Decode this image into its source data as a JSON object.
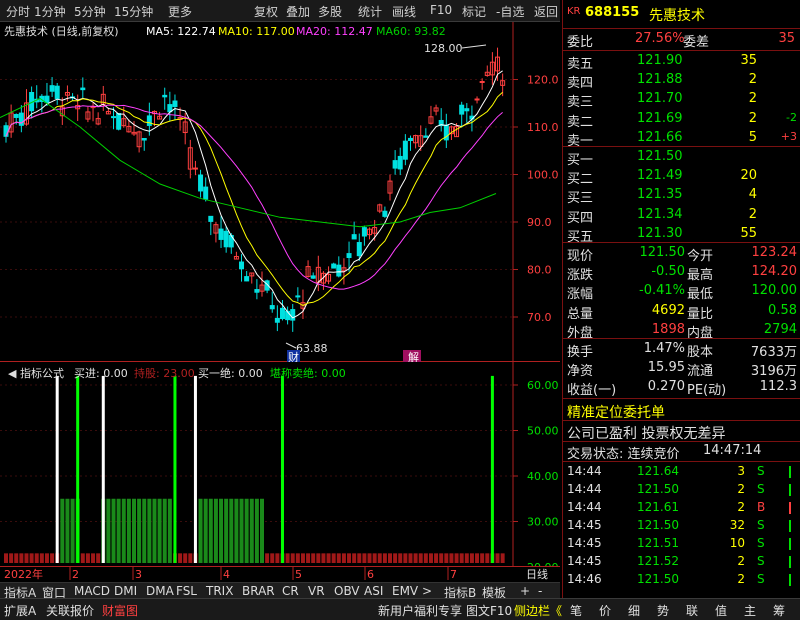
{
  "toolbar": {
    "items": [
      "分时",
      "1分钟",
      "5分钟",
      "15分钟",
      "更多",
      "复权",
      "叠加",
      "多股",
      "统计",
      "画线",
      "F10",
      "标记",
      "-自选",
      "返回"
    ]
  },
  "chart": {
    "title": "先惠技术 (日线,前复权)",
    "ma5": "MA5: 122.74",
    "ma10": "MA10: 117.00",
    "ma20": "MA20: 112.47",
    "ma60": "MA60: 93.82",
    "high_label": "128.00",
    "low_label": "63.88",
    "price_ticks": [
      "120.0",
      "110.0",
      "100.0",
      "90.0",
      "80.0",
      "70.0"
    ],
    "marker_cai": "财",
    "marker_jie": "解",
    "colors": {
      "up": "#ff4040",
      "down": "#00e0e0",
      "ma5": "#ffffff",
      "ma10": "#ffff00",
      "ma20": "#ff40ff",
      "ma60": "#00d000"
    }
  },
  "indicator": {
    "name": "指标公式",
    "buy": "买进: 0.00",
    "hold": "持股: 23.00",
    "buy_one": "买一绝: 0.00",
    "sell": "堪称卖绝: 0.00",
    "ticks": [
      "60.00",
      "50.00",
      "40.00",
      "30.00",
      "20.00"
    ]
  },
  "date_axis": {
    "year": "2022年",
    "months": [
      "2",
      "3",
      "4",
      "5",
      "6",
      "7"
    ],
    "period": "日线"
  },
  "tabs": [
    "指标A",
    "窗口",
    "MACD",
    "DMI",
    "DMA",
    "FSL",
    "TRIX",
    "BRAR",
    "CR",
    "VR",
    "OBV",
    "ASI",
    "EMV",
    ">",
    "指标B",
    "模板",
    "+",
    "-"
  ],
  "bottom": {
    "left": [
      "扩展A",
      "关联报价",
      "财富图"
    ],
    "right": [
      "新用户福利专享",
      "图文F10",
      "侧边栏《"
    ],
    "panel_tabs": [
      "笔",
      "价",
      "细",
      "势",
      "联",
      "值",
      "主",
      "筹"
    ]
  },
  "quote": {
    "badge": "KR",
    "code": "688155",
    "name": "先惠技术",
    "weibi_label": "委比",
    "weibi": "27.56%",
    "weicha_label": "委差",
    "weicha": "35",
    "asks": [
      {
        "l": "卖五",
        "p": "121.90",
        "v": "35",
        "c": ""
      },
      {
        "l": "卖四",
        "p": "121.88",
        "v": "2",
        "c": ""
      },
      {
        "l": "卖三",
        "p": "121.70",
        "v": "2",
        "c": ""
      },
      {
        "l": "卖二",
        "p": "121.69",
        "v": "2",
        "c": "-2"
      },
      {
        "l": "卖一",
        "p": "121.66",
        "v": "5",
        "c": "+3"
      }
    ],
    "bids": [
      {
        "l": "买一",
        "p": "121.50",
        "v": ""
      },
      {
        "l": "买二",
        "p": "121.49",
        "v": "20"
      },
      {
        "l": "买三",
        "p": "121.35",
        "v": "4"
      },
      {
        "l": "买四",
        "p": "121.34",
        "v": "2"
      },
      {
        "l": "买五",
        "p": "121.30",
        "v": "55"
      }
    ],
    "stats": [
      {
        "a": "现价",
        "b": "121.50",
        "c": "今开",
        "d": "123.24"
      },
      {
        "a": "涨跌",
        "b": "-0.50",
        "c": "最高",
        "d": "124.20"
      },
      {
        "a": "涨幅",
        "b": "-0.41%",
        "c": "最低",
        "d": "120.00"
      },
      {
        "a": "总量",
        "b": "4692",
        "c": "量比",
        "d": "0.58"
      },
      {
        "a": "外盘",
        "b": "1898",
        "c": "内盘",
        "d": "2794"
      }
    ],
    "stats2": [
      {
        "a": "换手",
        "b": "1.47%",
        "c": "股本",
        "d": "7633万"
      },
      {
        "a": "净资",
        "b": "15.95",
        "c": "流通",
        "d": "3196万"
      },
      {
        "a": "收益(一)",
        "b": "0.270",
        "c": "PE(动)",
        "d": "112.3"
      }
    ],
    "info1": "精准定位委托单",
    "info2": "公司已盈利 投票权无差异",
    "status_label": "交易状态: 连续竞价",
    "status_time": "14:47:14",
    "ticks": [
      {
        "t": "14:44",
        "p": "121.64",
        "v": "3",
        "d": "S"
      },
      {
        "t": "14:44",
        "p": "121.50",
        "v": "2",
        "d": "S"
      },
      {
        "t": "14:44",
        "p": "121.61",
        "v": "2",
        "d": "B"
      },
      {
        "t": "14:45",
        "p": "121.50",
        "v": "32",
        "d": "S"
      },
      {
        "t": "14:45",
        "p": "121.51",
        "v": "10",
        "d": "S"
      },
      {
        "t": "14:45",
        "p": "121.52",
        "v": "2",
        "d": "S"
      },
      {
        "t": "14:46",
        "p": "121.50",
        "v": "2",
        "d": "S"
      }
    ]
  }
}
